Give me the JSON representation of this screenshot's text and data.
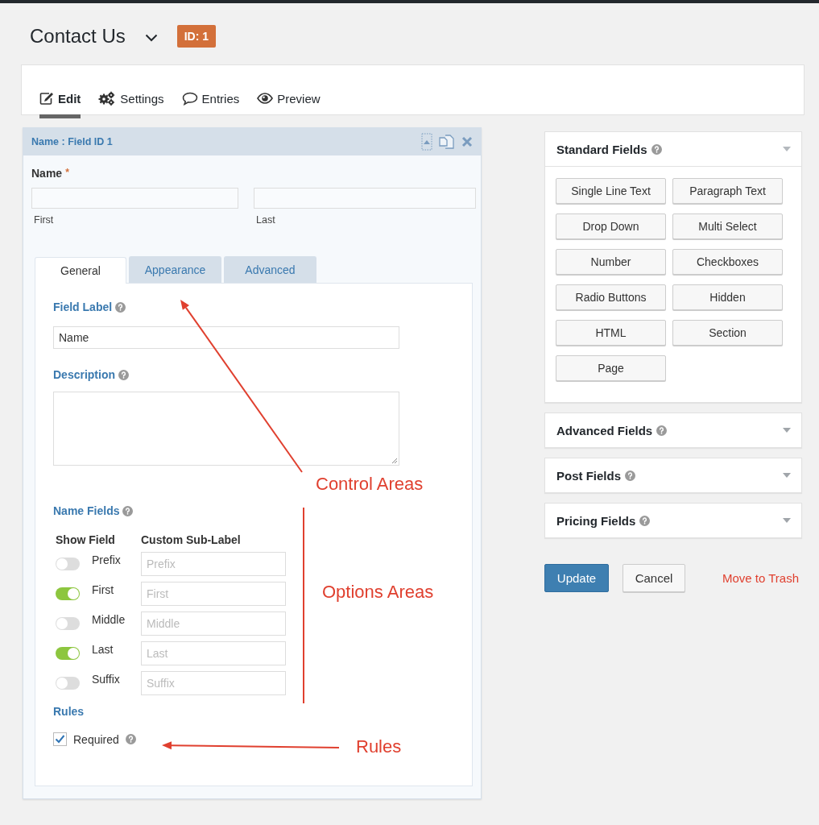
{
  "form": {
    "title": "Contact Us",
    "id_badge": "ID: 1"
  },
  "nav_tabs": [
    {
      "label": "Edit",
      "selected": true
    },
    {
      "label": "Settings",
      "selected": false
    },
    {
      "label": "Entries",
      "selected": false
    },
    {
      "label": "Preview",
      "selected": false
    }
  ],
  "field_panel": {
    "header": "Name : Field ID 1",
    "preview_label": "Name",
    "required_mark": "*",
    "preview_inputs": [
      {
        "sublabel": "First"
      },
      {
        "sublabel": "Last"
      }
    ],
    "tabs": [
      {
        "label": "General",
        "selected": true
      },
      {
        "label": "Appearance",
        "selected": false
      },
      {
        "label": "Advanced",
        "selected": false
      }
    ],
    "field_label": {
      "label": "Field Label",
      "value": "Name"
    },
    "description": {
      "label": "Description"
    },
    "name_fields": {
      "label": "Name Fields",
      "columns": [
        "Show Field",
        "Custom Sub-Label"
      ],
      "rows": [
        {
          "name": "Prefix",
          "on": false,
          "placeholder": "Prefix"
        },
        {
          "name": "First",
          "on": true,
          "placeholder": "First"
        },
        {
          "name": "Middle",
          "on": false,
          "placeholder": "Middle"
        },
        {
          "name": "Last",
          "on": true,
          "placeholder": "Last"
        },
        {
          "name": "Suffix",
          "on": false,
          "placeholder": "Suffix"
        }
      ]
    },
    "rules": {
      "label": "Rules",
      "items": [
        {
          "label": "Required",
          "checked": true
        }
      ]
    }
  },
  "sidebar": {
    "sections": [
      {
        "title": "Standard Fields",
        "expanded": true,
        "buttons": [
          "Single Line Text",
          "Paragraph Text",
          "Drop Down",
          "Multi Select",
          "Number",
          "Checkboxes",
          "Radio Buttons",
          "Hidden",
          "HTML",
          "Section",
          "Page"
        ]
      },
      {
        "title": "Advanced Fields",
        "expanded": false
      },
      {
        "title": "Post Fields",
        "expanded": false
      },
      {
        "title": "Pricing Fields",
        "expanded": false
      }
    ],
    "actions": {
      "primary": "Update",
      "secondary": "Cancel",
      "danger": "Move to Trash"
    }
  },
  "annotations": [
    {
      "kind": "arrow",
      "text": "Control Areas"
    },
    {
      "kind": "line",
      "text": "Options Areas"
    },
    {
      "kind": "arrow",
      "text": "Rules"
    }
  ]
}
